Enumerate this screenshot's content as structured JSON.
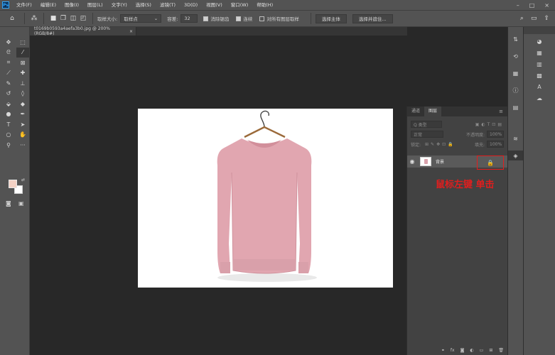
{
  "app": {
    "logo": "Ps"
  },
  "menu": [
    "文件(F)",
    "编辑(E)",
    "图像(I)",
    "图层(L)",
    "文字(Y)",
    "选择(S)",
    "滤镜(T)",
    "3D(D)",
    "视图(V)",
    "窗口(W)",
    "帮助(H)"
  ],
  "window_controls": {
    "minimize": "–",
    "maximize": "□",
    "close": "×"
  },
  "options": {
    "sample_size_label": "取样大小:",
    "sample_size_value": "取样点",
    "tolerance_label": "容差:",
    "tolerance_value": "32",
    "antialias_label": "消除锯齿",
    "contiguous_label": "连续",
    "sample_all_label": "对所有图层取样",
    "select_subject": "选择主体",
    "select_and_mask": "选择并遮住..."
  },
  "document": {
    "tab_label": "t0169b0593a4aefa3b0.jpg @ 200%(RGB/8#)",
    "close": "×"
  },
  "colors": {
    "foreground": "#f3d1c4",
    "background": "#ffffff",
    "highlight": "#e11e1e"
  },
  "layers_panel": {
    "tab_channels": "通道",
    "tab_layers": "图层",
    "filter_placeholder": "Q 类型",
    "blend_mode": "正常",
    "opacity_label": "不透明度:",
    "opacity_value": "100%",
    "lock_label": "锁定:",
    "fill_label": "填充:",
    "fill_value": "100%",
    "layer_name": "背景",
    "annotation": "鼠标左键 单击"
  },
  "icons": {
    "tools": [
      "move-icon",
      "marquee-icon",
      "lasso-icon",
      "magic-wand-icon",
      "crop-icon",
      "frame-icon",
      "eyedropper-icon",
      "healing-icon",
      "brush-icon",
      "stamp-icon",
      "history-brush-icon",
      "eraser-icon",
      "bucket-icon",
      "blur-icon",
      "dodge-icon",
      "pen-icon",
      "text-icon",
      "path-select-icon",
      "ellipse-icon",
      "hand-icon",
      "zoom-icon",
      "more-icon"
    ]
  }
}
